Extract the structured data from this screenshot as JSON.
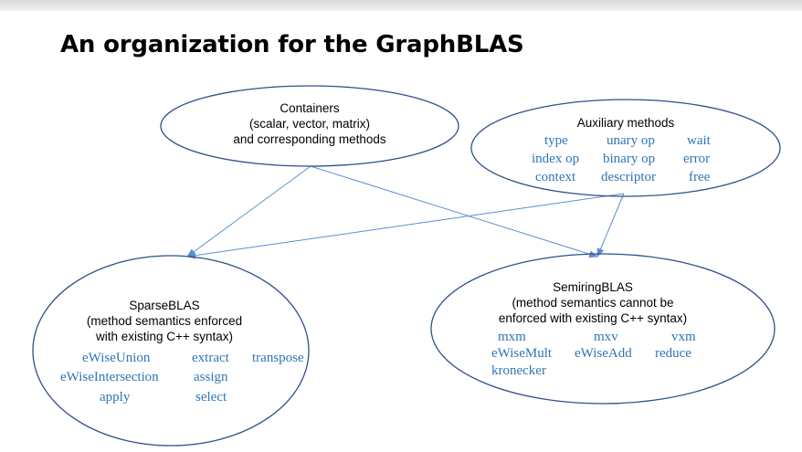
{
  "title": "An organization for the GraphBLAS",
  "colors": {
    "ellipse_stroke": "#2f4f8a",
    "connector": "#5b8fd0",
    "method_text": "#2e75b6"
  },
  "nodes": {
    "containers": {
      "lines": [
        "Containers",
        "(scalar, vector, matrix)",
        "and corresponding methods"
      ]
    },
    "auxiliary": {
      "heading": "Auxiliary methods",
      "methods": [
        [
          "type",
          "unary op",
          "wait"
        ],
        [
          "index op",
          "binary op",
          "error"
        ],
        [
          "context",
          "descriptor",
          "free"
        ]
      ]
    },
    "sparseblas": {
      "lines": [
        "SparseBLAS",
        "(method semantics enforced",
        "with existing C++ syntax)"
      ],
      "methods": [
        [
          "eWiseUnion",
          "extract",
          "transpose"
        ],
        [
          "eWiseIntersection",
          "assign"
        ],
        [
          "apply",
          "select"
        ]
      ]
    },
    "semiringblas": {
      "lines": [
        "SemiringBLAS",
        "(method semantics cannot be",
        "enforced with existing C++ syntax)"
      ],
      "methods": [
        [
          "mxm",
          "mxv",
          "vxm"
        ],
        [
          "eWiseMult",
          "eWiseAdd",
          "reduce"
        ],
        [
          "kronecker"
        ]
      ]
    }
  },
  "edges": [
    {
      "from": "containers",
      "to": "sparseblas"
    },
    {
      "from": "containers",
      "to": "semiringblas"
    },
    {
      "from": "auxiliary",
      "to": "sparseblas"
    },
    {
      "from": "auxiliary",
      "to": "semiringblas"
    }
  ]
}
